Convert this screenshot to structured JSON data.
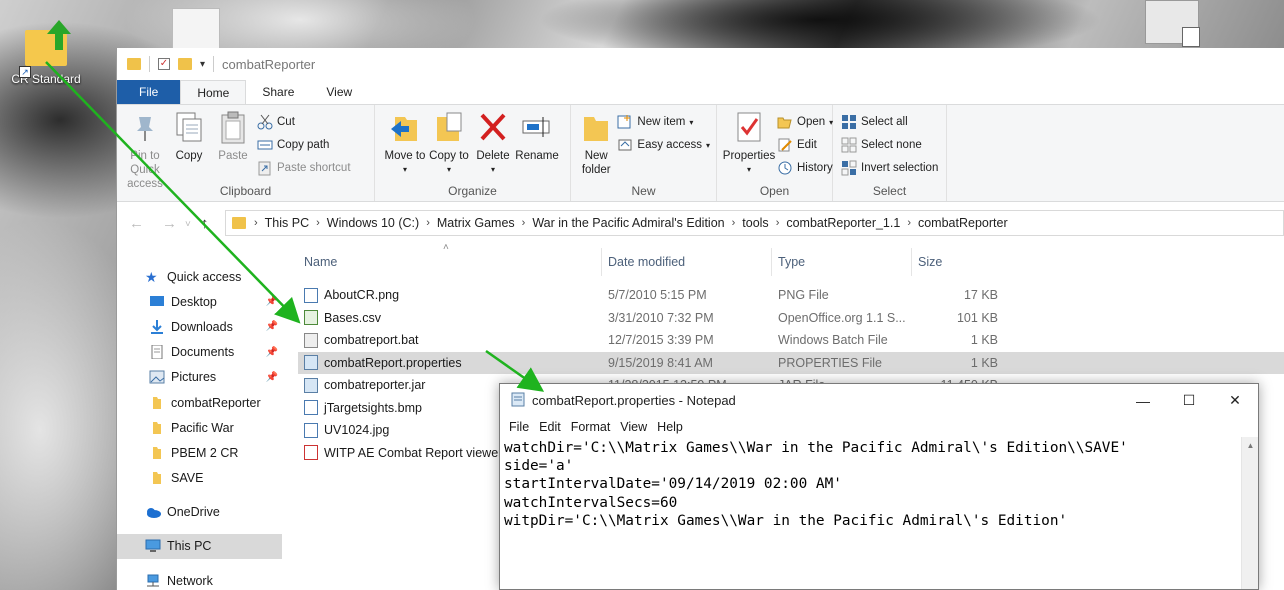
{
  "desktop": {
    "icon_label": "CR Standard"
  },
  "explorer": {
    "title": "combatReporter",
    "tabs": [
      "File",
      "Home",
      "Share",
      "View"
    ],
    "active_tab": "Home",
    "ribbon": {
      "clipboard": {
        "pin": "Pin to Quick access",
        "copy": "Copy",
        "paste": "Paste",
        "cut": "Cut",
        "copy_path": "Copy path",
        "paste_shortcut": "Paste shortcut",
        "label": "Clipboard"
      },
      "organize": {
        "move_to": "Move to",
        "copy_to": "Copy to",
        "delete": "Delete",
        "rename": "Rename",
        "label": "Organize"
      },
      "new": {
        "new_folder": "New folder",
        "new_item": "New item",
        "easy_access": "Easy access",
        "label": "New"
      },
      "open": {
        "properties": "Properties",
        "open": "Open",
        "edit": "Edit",
        "history": "History",
        "label": "Open"
      },
      "select": {
        "select_all": "Select all",
        "select_none": "Select none",
        "invert": "Invert selection",
        "label": "Select"
      }
    },
    "breadcrumb": [
      "This PC",
      "Windows 10 (C:)",
      "Matrix Games",
      "War in the Pacific Admiral's Edition",
      "tools",
      "combatReporter_1.1",
      "combatReporter"
    ],
    "nav": {
      "quick_access": "Quick access",
      "items": [
        {
          "label": "Desktop",
          "pinned": true
        },
        {
          "label": "Downloads",
          "pinned": true
        },
        {
          "label": "Documents",
          "pinned": true
        },
        {
          "label": "Pictures",
          "pinned": true
        },
        {
          "label": "combatReporter",
          "pinned": false
        },
        {
          "label": "Pacific War",
          "pinned": false
        },
        {
          "label": "PBEM 2 CR",
          "pinned": false
        },
        {
          "label": "SAVE",
          "pinned": false
        }
      ],
      "onedrive": "OneDrive",
      "this_pc": "This PC",
      "network": "Network"
    },
    "columns": [
      "Name",
      "Date modified",
      "Type",
      "Size"
    ],
    "files": [
      {
        "name": "AboutCR.png",
        "date": "5/7/2010 5:15 PM",
        "type": "PNG File",
        "size": "17 KB"
      },
      {
        "name": "Bases.csv",
        "date": "3/31/2010 7:32 PM",
        "type": "OpenOffice.org 1.1 S...",
        "size": "101 KB"
      },
      {
        "name": "combatreport.bat",
        "date": "12/7/2015 3:39 PM",
        "type": "Windows Batch File",
        "size": "1 KB"
      },
      {
        "name": "combatReport.properties",
        "date": "9/15/2019 8:41 AM",
        "type": "PROPERTIES File",
        "size": "1 KB"
      },
      {
        "name": "combatreporter.jar",
        "date": "11/28/2015 12:59 PM",
        "type": "JAR File",
        "size": "11,450 KB"
      },
      {
        "name": "jTargetsights.bmp",
        "date": "",
        "type": "",
        "size": ""
      },
      {
        "name": "UV1024.jpg",
        "date": "",
        "type": "",
        "size": ""
      },
      {
        "name": "WITP AE Combat Report viewer",
        "date": "",
        "type": "",
        "size": ""
      }
    ],
    "selected_file_index": 3
  },
  "notepad": {
    "title": "combatReport.properties - Notepad",
    "menu": [
      "File",
      "Edit",
      "Format",
      "View",
      "Help"
    ],
    "lines": [
      "watchDir='C:\\\\Matrix Games\\\\War in the Pacific Admiral\\'s Edition\\\\SAVE'",
      "side='a'",
      "startIntervalDate='09/14/2019 02:00 AM'",
      "watchIntervalSecs=60",
      "witpDir='C:\\\\Matrix Games\\\\War in the Pacific Admiral\\'s Edition'"
    ]
  },
  "colors": {
    "file_tab": "#1e5ea8",
    "annotation_arrow": "#1fb31f",
    "selection": "#d9d9d9"
  }
}
